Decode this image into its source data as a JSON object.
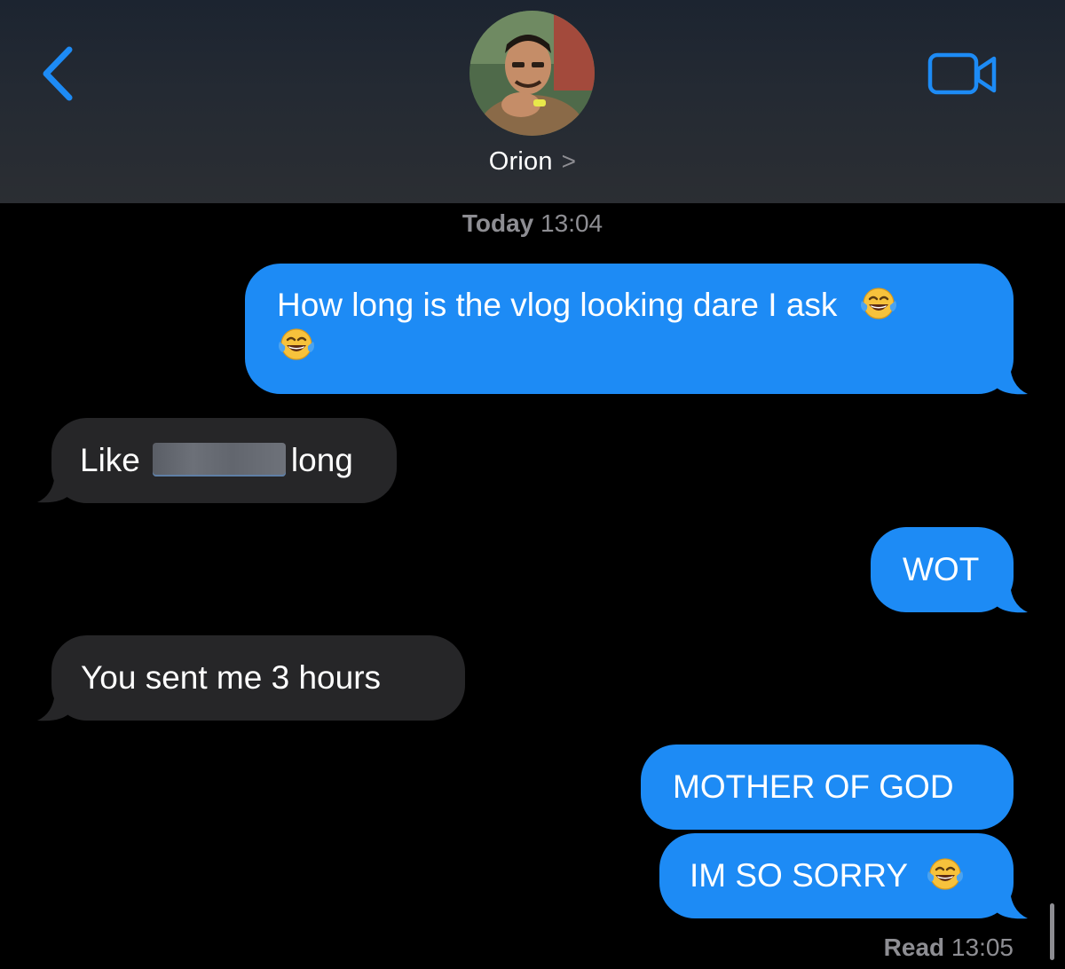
{
  "header": {
    "contact_name": "Orion",
    "chevron": ">",
    "back_icon": "chevron-left-icon",
    "video_icon": "video-camera-icon",
    "accent_color": "#1d8bf5"
  },
  "timestamp": {
    "day": "Today",
    "time": "13:04"
  },
  "messages": [
    {
      "side": "sent",
      "text": "How long is the vlog looking dare I ask",
      "emoji": "face-with-tears-of-joy"
    },
    {
      "side": "received",
      "text_before": "Like",
      "text_after": "long",
      "redacted": true
    },
    {
      "side": "sent",
      "text": "WOT"
    },
    {
      "side": "received",
      "text": "You sent me 3 hours"
    },
    {
      "side": "sent",
      "text": "MOTHER OF GOD"
    },
    {
      "side": "sent",
      "text": "IM SO SORRY",
      "emoji": "face-with-tears-of-joy"
    }
  ],
  "receipt": {
    "status": "Read",
    "time": "13:05"
  },
  "colors": {
    "sent_bubble": "#1d8bf5",
    "received_bubble": "#262628",
    "meta_text": "#8e8e93"
  }
}
